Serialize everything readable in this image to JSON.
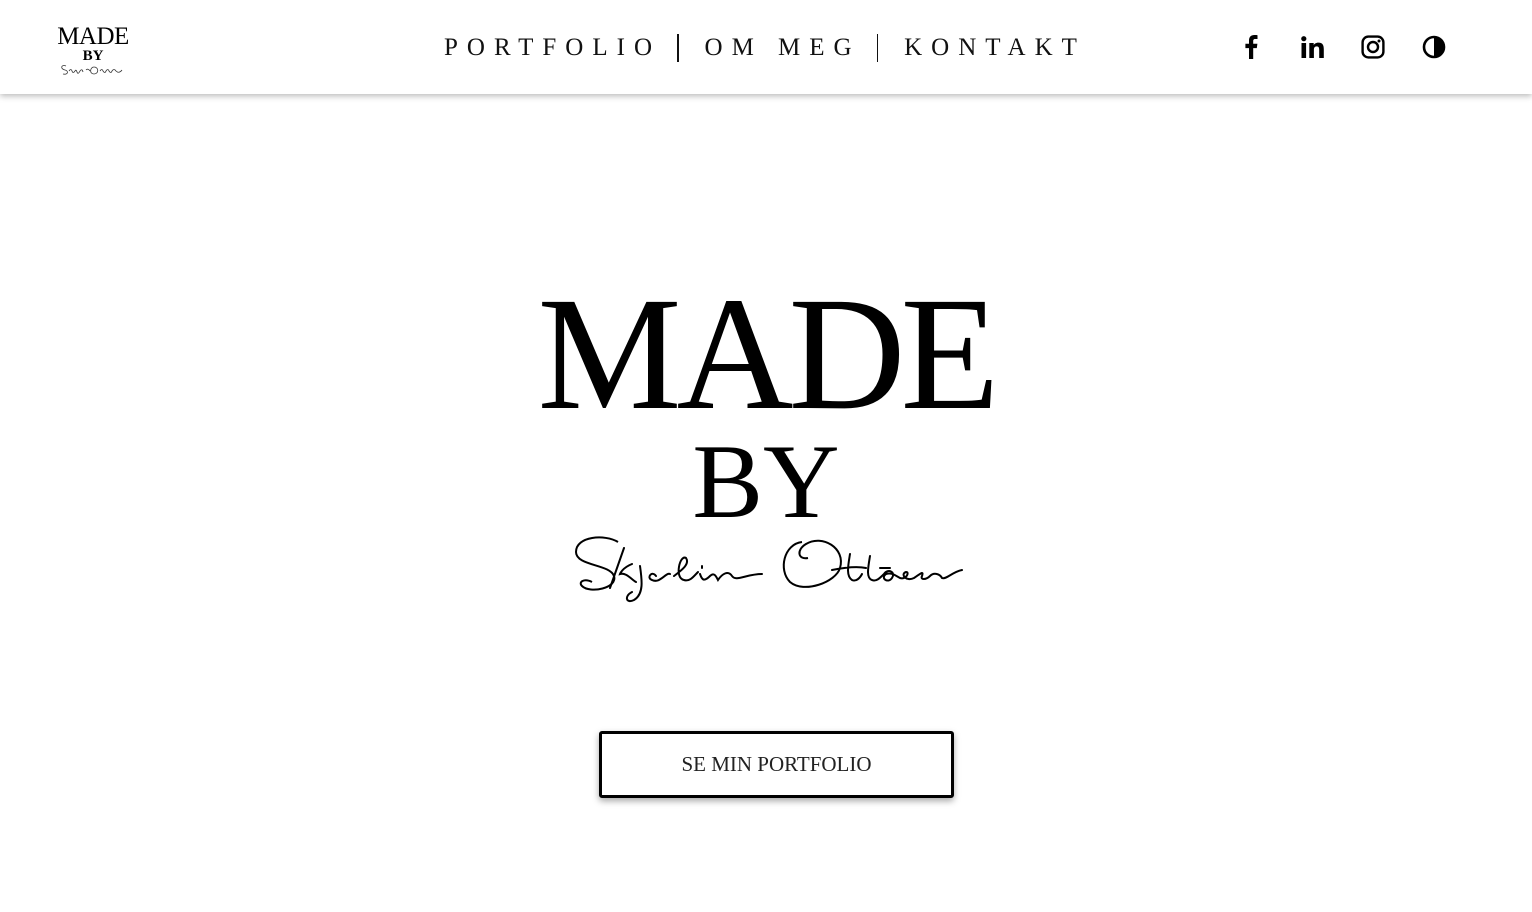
{
  "logo": {
    "line1": "MADE",
    "line2": "BY",
    "signature": "Skjelin Ottosen"
  },
  "nav": {
    "items": [
      {
        "label": "PORTFOLIO"
      },
      {
        "label": "OM MEG"
      },
      {
        "label": "KONTAKT"
      }
    ]
  },
  "social": {
    "icons": [
      "facebook-icon",
      "linkedin-icon",
      "instagram-icon",
      "contrast-toggle-icon"
    ]
  },
  "hero": {
    "line1": "MADE",
    "line2": "BY",
    "signature": "Skjelin Ottosen",
    "cta_label": "SE MIN PORTFOLIO"
  },
  "colors": {
    "background": "#ffffff",
    "text": "#000000",
    "header_shadow": "rgba(0,0,0,0.28)"
  }
}
